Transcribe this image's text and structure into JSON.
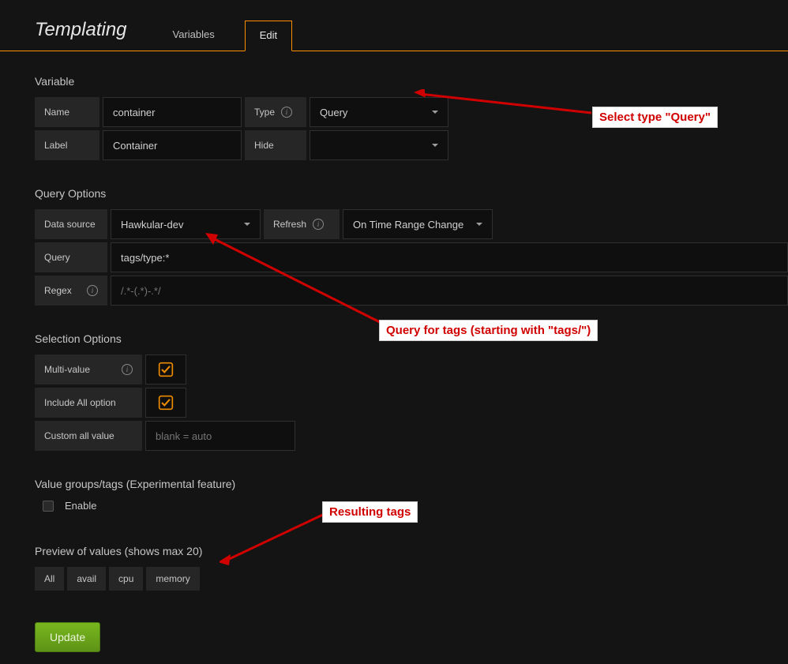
{
  "header": {
    "title": "Templating",
    "tabs": {
      "variables": "Variables",
      "edit": "Edit"
    }
  },
  "variable": {
    "section_title": "Variable",
    "name_label": "Name",
    "name_value": "container",
    "type_label": "Type",
    "type_value": "Query",
    "label_label": "Label",
    "label_value": "Container",
    "hide_label": "Hide",
    "hide_value": ""
  },
  "query_options": {
    "section_title": "Query Options",
    "datasource_label": "Data source",
    "datasource_value": "Hawkular-dev",
    "refresh_label": "Refresh",
    "refresh_value": "On Time Range Change",
    "query_label": "Query",
    "query_value": "tags/type:*",
    "regex_label": "Regex",
    "regex_placeholder": "/.*-(.*)-.*/"
  },
  "selection_options": {
    "section_title": "Selection Options",
    "multi_value_label": "Multi-value",
    "multi_value_checked": true,
    "include_all_label": "Include All option",
    "include_all_checked": true,
    "custom_all_label": "Custom all value",
    "custom_all_placeholder": "blank = auto"
  },
  "value_groups": {
    "section_title": "Value groups/tags (Experimental feature)",
    "enable_label": "Enable",
    "enable_checked": false
  },
  "preview": {
    "section_title": "Preview of values (shows max 20)",
    "values": [
      "All",
      "avail",
      "cpu",
      "memory"
    ]
  },
  "buttons": {
    "update": "Update"
  },
  "annotations": {
    "select_type": "Select type \"Query\"",
    "query_tags": "Query for tags (starting with \"tags/\")",
    "resulting_tags": "Resulting tags"
  }
}
